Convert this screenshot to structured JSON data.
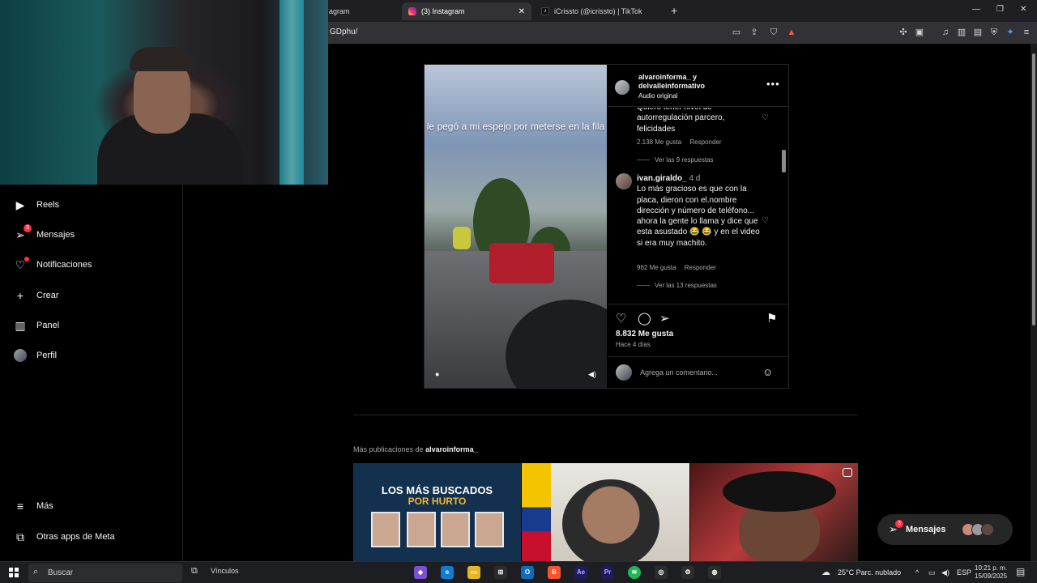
{
  "browser": {
    "tabs": [
      {
        "title": "agram"
      },
      {
        "title": "(3) Instagram",
        "active": true
      },
      {
        "title": "iCrissto (@icrissto) | TikTok"
      }
    ],
    "new_tab": "+",
    "url": "GDphu/"
  },
  "sidebar": {
    "items": [
      {
        "label": "Reels",
        "icon": "reels-icon"
      },
      {
        "label": "Mensajes",
        "icon": "messages-icon",
        "badge": "3"
      },
      {
        "label": "Notificaciones",
        "icon": "heart-icon"
      },
      {
        "label": "Crear",
        "icon": "plus-icon"
      },
      {
        "label": "Panel",
        "icon": "chart-icon"
      },
      {
        "label": "Perfil",
        "icon": "avatar"
      }
    ],
    "bottom": [
      {
        "label": "Más",
        "icon": "menu-icon"
      },
      {
        "label": "Otras apps de Meta",
        "icon": "apps-icon"
      }
    ]
  },
  "post": {
    "video_caption": "le pegó a mi espejo por meterse en la fila",
    "author_line1": "alvaroinforma_ y",
    "author_line2": "delvalleinformativo",
    "audio": "Audio original",
    "comments": [
      {
        "text": "Quiero tener nivel de autorregulación parcero, felicidades",
        "likes": "2.138 Me gusta",
        "reply": "Responder",
        "replies": "Ver las 9 respuestas"
      },
      {
        "user": "ivan.giraldo_",
        "age": "4 d",
        "text": "Lo más gracioso es que con la placa, dieron con el.nombre dirección y número de teléfono... ahora la gente lo llama y dice que esta asustado 😂 😂 y en el video si era muy machito.",
        "likes": "962 Me gusta",
        "reply": "Responder",
        "replies": "Ver las 13 respuestas"
      }
    ],
    "likes": "8.832 Me gusta",
    "ago": "Hace 4 días",
    "add_comment_placeholder": "Agrega un comentario..."
  },
  "more_posts": {
    "prefix": "Más publicaciones de",
    "account": "alvaroinforma_",
    "thumb1_line1": "LOS MÁS BUSCADOS",
    "thumb1_line2": "POR HURTO"
  },
  "messages_pill": {
    "label": "Mensajes",
    "badge": "3"
  },
  "taskbar": {
    "search": "Buscar",
    "links": "Vínculos",
    "weather": "25°C  Parc. nublado",
    "lang": "ESP",
    "time": "10:21 p. m.",
    "date": "15/09/2025"
  },
  "colors": {
    "background": "#000000",
    "badge": "#ff3040",
    "secondary_text": "#a8a8a8",
    "border": "#262626"
  }
}
